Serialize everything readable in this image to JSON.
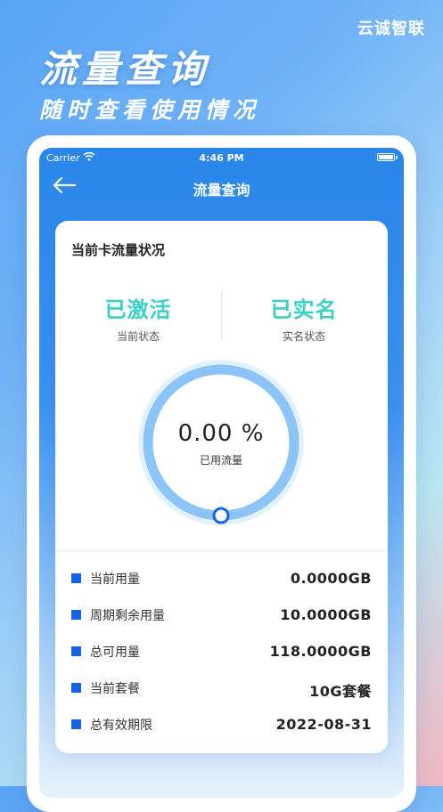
{
  "brand": "云诚智联",
  "hero": {
    "title": "流量查询",
    "subtitle": "随时查看使用情况"
  },
  "statusbar": {
    "carrier": "Carrier",
    "time": "4:46 PM"
  },
  "nav": {
    "title": "流量查询"
  },
  "card": {
    "title": "当前卡流量状况",
    "status": [
      {
        "value": "已激活",
        "label": "当前状态"
      },
      {
        "value": "已实名",
        "label": "实名状态"
      }
    ],
    "gauge": {
      "percent_text": "0.00 %",
      "label": "已用流量",
      "fraction": 0
    },
    "details": [
      {
        "label": "当前用量",
        "value": "0.0000GB"
      },
      {
        "label": "周期剩余用量",
        "value": "10.0000GB"
      },
      {
        "label": "总可用量",
        "value": "118.0000GB"
      },
      {
        "label": "当前套餐",
        "value": "10G套餐"
      },
      {
        "label": "总有效期限",
        "value": "2022-08-31"
      }
    ]
  },
  "colors": {
    "accent": "#1463e6",
    "status_text": "#3bd1c6",
    "gauge_ring": "#8cc4f8",
    "gauge_halo": "#e3f0fd"
  }
}
